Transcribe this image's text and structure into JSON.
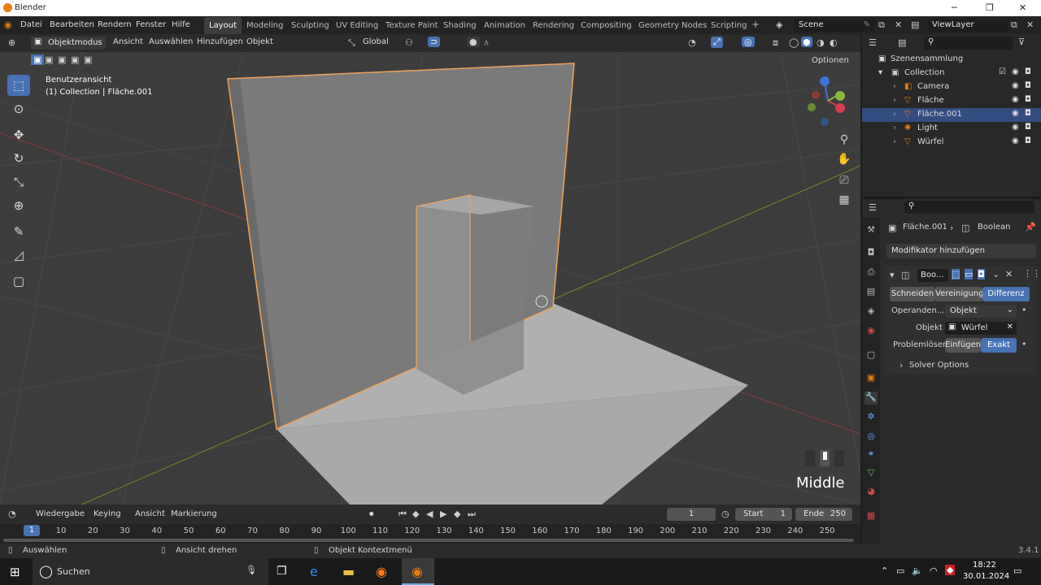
{
  "window": {
    "title": "Blender",
    "min": "─",
    "max": "❐",
    "close": "✕"
  },
  "menu": {
    "items": [
      "Datei",
      "Bearbeiten",
      "Rendern",
      "Fenster",
      "Hilfe"
    ]
  },
  "workspaces": [
    "Layout",
    "Modeling",
    "Sculpting",
    "UV Editing",
    "Texture Paint",
    "Shading",
    "Animation",
    "Rendering",
    "Compositing",
    "Geometry Nodes",
    "Scripting"
  ],
  "workspace_add": "+",
  "scene": {
    "name": "Scene",
    "viewlayer": "ViewLayer"
  },
  "viewport_header": {
    "mode": "Objektmodus",
    "menus": [
      "Ansicht",
      "Auswählen",
      "Hinzufügen",
      "Objekt"
    ],
    "transform": "Global",
    "optionen": "Optionen"
  },
  "viewport": {
    "view_name": "Benutzeransicht",
    "collection_info": "(1) Collection | Fläche.001",
    "overlay_text": "Middle"
  },
  "outliner": {
    "root": "Szenensammlung",
    "collection": "Collection",
    "items": [
      {
        "name": "Camera",
        "icon": "camera-icon"
      },
      {
        "name": "Fläche",
        "icon": "mesh-icon"
      },
      {
        "name": "Fläche.001",
        "icon": "mesh-icon",
        "selected": true
      },
      {
        "name": "Light",
        "icon": "light-icon"
      },
      {
        "name": "Würfel",
        "icon": "mesh-icon"
      }
    ]
  },
  "properties": {
    "breadcrumb_object": "Fläche.001",
    "breadcrumb_modifier": "Boolean",
    "add_modifier": "Modifikator hinzufügen",
    "modifier_name": "Boo...",
    "ops": [
      "Schneiden",
      "Vereinigung",
      "Differenz"
    ],
    "active_op": "Differenz",
    "operand_label": "Operanden...",
    "operand_value": "Objekt",
    "object_label": "Objekt",
    "object_value": "Würfel",
    "solver_label": "Problemlöser",
    "solver_opts": [
      "Einfügen",
      "Exakt"
    ],
    "active_solver": "Exakt",
    "solver_options": "Solver Options"
  },
  "timeline": {
    "menus": [
      "Wiedergabe",
      "Keying",
      "Ansicht",
      "Markierung"
    ],
    "current_frame": "1",
    "start_label": "Start",
    "start": "1",
    "end_label": "Ende",
    "end": "250",
    "ruler": [
      "10",
      "20",
      "30",
      "40",
      "50",
      "60",
      "70",
      "80",
      "90",
      "100",
      "110",
      "120",
      "130",
      "140",
      "150",
      "160",
      "170",
      "180",
      "190",
      "200",
      "210",
      "220",
      "230",
      "240",
      "250"
    ],
    "ruler_current": "1"
  },
  "status": {
    "left": "Auswählen",
    "middle": "Ansicht drehen",
    "right": "Objekt Kontextmenü",
    "version": "3.4.1"
  },
  "taskbar": {
    "search": "Suchen",
    "time": "18:22",
    "date": "30.01.2024"
  },
  "colors": {
    "accent": "#4772b3",
    "selection_outline": "#f0a35a",
    "blender_orange": "#e87d0d"
  }
}
